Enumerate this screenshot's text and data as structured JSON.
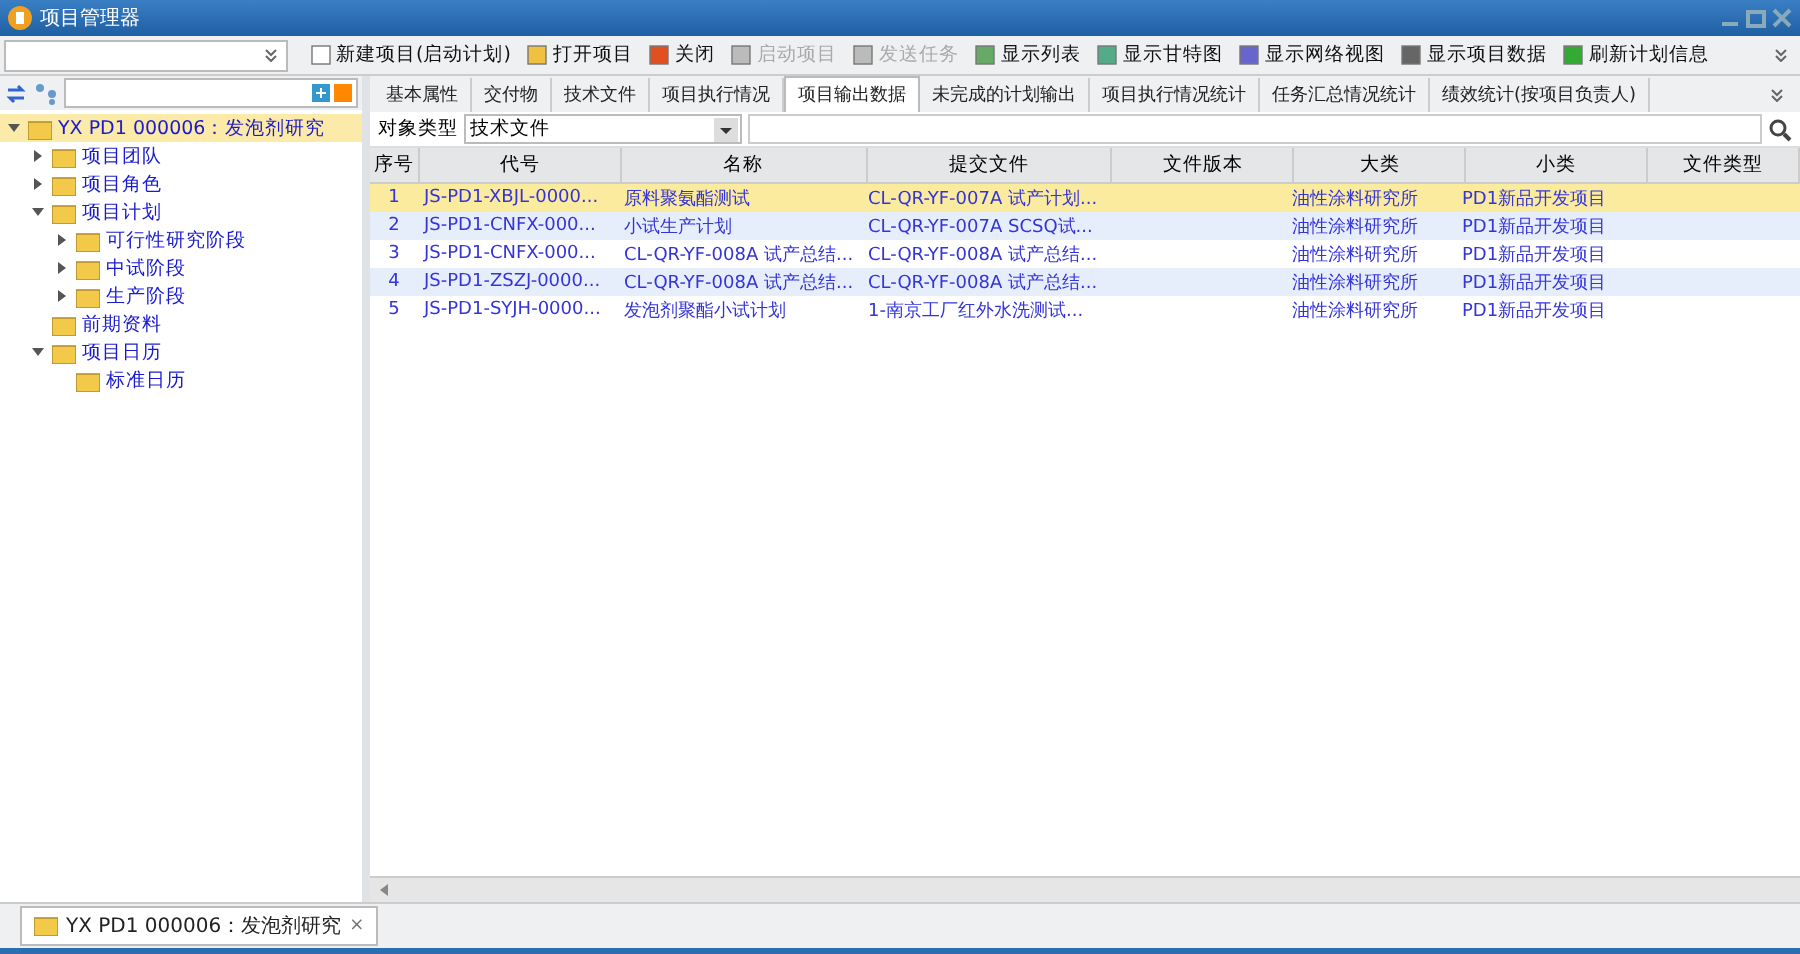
{
  "window": {
    "title": "项目管理器"
  },
  "toolbar": [
    {
      "label": "新建项目(启动计划)",
      "disabled": false
    },
    {
      "label": "打开项目",
      "disabled": false
    },
    {
      "label": "关闭",
      "disabled": false
    },
    {
      "label": "启动项目",
      "disabled": true
    },
    {
      "label": "发送任务",
      "disabled": true
    },
    {
      "label": "显示列表",
      "disabled": false
    },
    {
      "label": "显示甘特图",
      "disabled": false
    },
    {
      "label": "显示网络视图",
      "disabled": false
    },
    {
      "label": "显示项目数据",
      "disabled": false
    },
    {
      "label": "刷新计划信息",
      "disabled": false
    }
  ],
  "tabs": [
    {
      "label": "基本属性",
      "selected": false
    },
    {
      "label": "交付物",
      "selected": false
    },
    {
      "label": "技术文件",
      "selected": false
    },
    {
      "label": "项目执行情况",
      "selected": false
    },
    {
      "label": "项目输出数据",
      "selected": true
    },
    {
      "label": "未完成的计划输出",
      "selected": false
    },
    {
      "label": "项目执行情况统计",
      "selected": false
    },
    {
      "label": "任务汇总情况统计",
      "selected": false
    },
    {
      "label": "绩效统计(按项目负责人)",
      "selected": false
    }
  ],
  "tree": [
    {
      "label": "YX PD1 000006：发泡剂研究",
      "expanded": true,
      "selected": true,
      "children": [
        {
          "label": "项目团队",
          "expanded": false,
          "selected": false
        },
        {
          "label": "项目角色",
          "expanded": false,
          "selected": false
        },
        {
          "label": "项目计划",
          "expanded": true,
          "selected": false,
          "children": [
            {
              "label": "可行性研究阶段",
              "expanded": false,
              "selected": false
            },
            {
              "label": "中试阶段",
              "expanded": false,
              "selected": false
            },
            {
              "label": "生产阶段",
              "expanded": false,
              "selected": false
            }
          ]
        },
        {
          "label": "前期资料",
          "selected": false
        },
        {
          "label": "项目日历",
          "expanded": true,
          "selected": false,
          "children": [
            {
              "label": "标准日历",
              "selected": false
            }
          ]
        }
      ]
    }
  ],
  "filter": {
    "label": "对象类型",
    "value": "技术文件"
  },
  "table": {
    "columns": [
      "序号",
      "代号",
      "名称",
      "提交文件",
      "文件版本",
      "大类",
      "小类",
      "文件类型"
    ],
    "rows": [
      {
        "selected": true,
        "cells": [
          "1",
          "JS-PD1-XBJL-0000...",
          "原料聚氨酯测试",
          "CL-QR-YF-007A 试产计划...",
          "",
          "油性涂料研究所",
          "PD1新品开发项目",
          ""
        ]
      },
      {
        "selected": false,
        "cells": [
          "2",
          "JS-PD1-CNFX-000...",
          "小试生产计划",
          "CL-QR-YF-007A SCSQ试...",
          "",
          "油性涂料研究所",
          "PD1新品开发项目",
          ""
        ]
      },
      {
        "selected": false,
        "cells": [
          "3",
          "JS-PD1-CNFX-000...",
          "CL-QR-YF-008A 试产总结...",
          "CL-QR-YF-008A 试产总结...",
          "",
          "油性涂料研究所",
          "PD1新品开发项目",
          ""
        ]
      },
      {
        "selected": false,
        "cells": [
          "4",
          "JS-PD1-ZSZJ-0000...",
          "CL-QR-YF-008A 试产总结...",
          "CL-QR-YF-008A 试产总结...",
          "",
          "油性涂料研究所",
          "PD1新品开发项目",
          ""
        ]
      },
      {
        "selected": false,
        "cells": [
          "5",
          "JS-PD1-SYJH-0000...",
          "发泡剂聚酯小试计划",
          "1-南京工厂红外水洗测试...",
          "",
          "油性涂料研究所",
          "PD1新品开发项目",
          ""
        ]
      }
    ]
  },
  "bottom_tab": {
    "label": "YX PD1 000006：发泡剂研究",
    "close": "×"
  }
}
